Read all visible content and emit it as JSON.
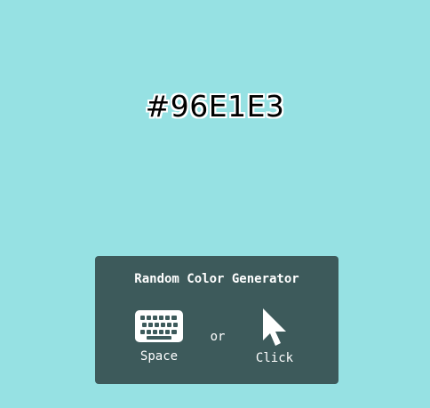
{
  "color": {
    "hex": "#96E1E3",
    "background": "#96E1E3"
  },
  "panel": {
    "title": "Random Color Generator",
    "background": "#3D5A5B",
    "separator": "or",
    "options": [
      {
        "label": "Space",
        "icon": "keyboard-icon"
      },
      {
        "label": "Click",
        "icon": "mouse-pointer-icon"
      }
    ]
  }
}
